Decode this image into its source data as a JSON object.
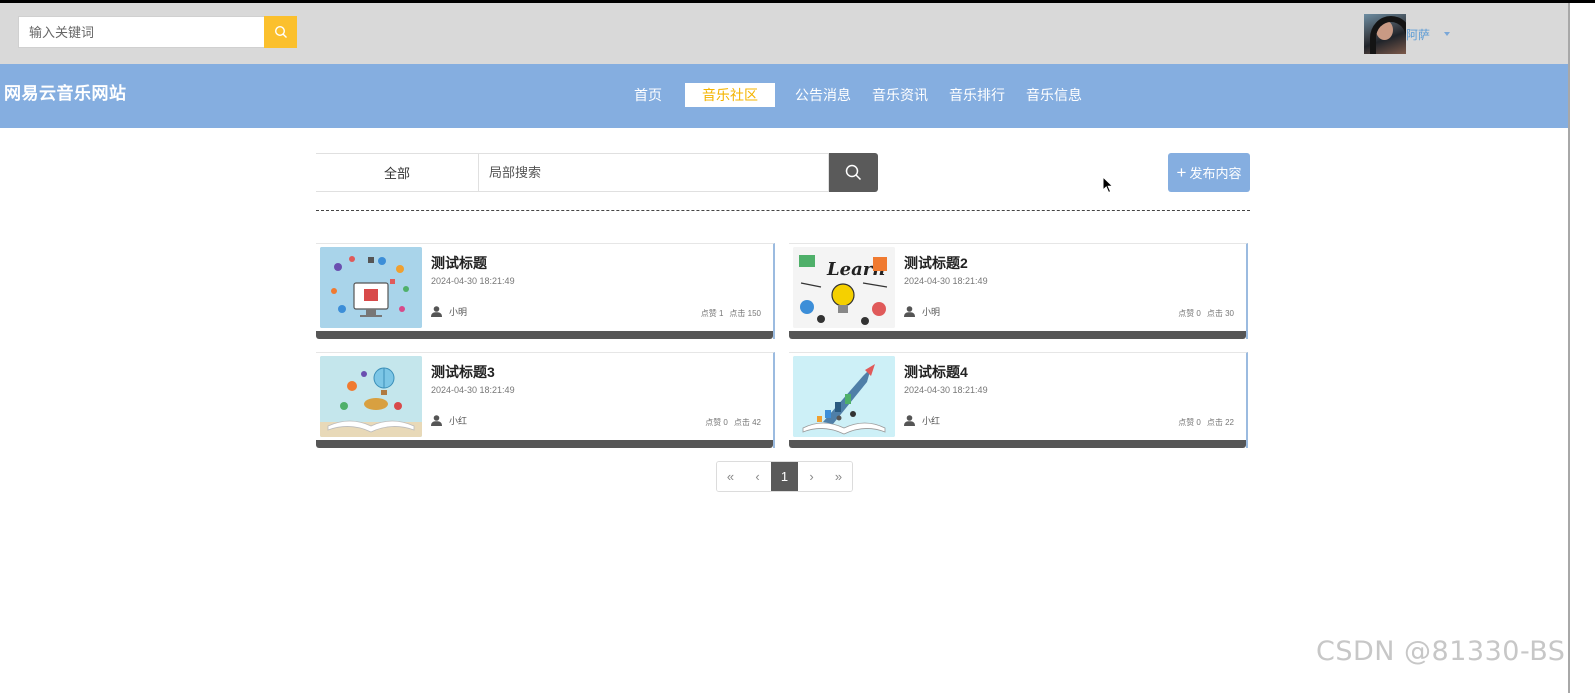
{
  "top": {
    "search_placeholder": "输入关键词",
    "user_name": "阿萨"
  },
  "site": {
    "logo": "网易云音乐网站"
  },
  "nav": [
    {
      "label": "首页",
      "active": false
    },
    {
      "label": "音乐社区",
      "active": true
    },
    {
      "label": "公告消息",
      "active": false
    },
    {
      "label": "音乐资讯",
      "active": false
    },
    {
      "label": "音乐排行",
      "active": false
    },
    {
      "label": "音乐信息",
      "active": false
    }
  ],
  "filter": {
    "category": "全部",
    "search_placeholder": "局部搜索",
    "publish_label": "发布内容",
    "publish_icon": "+"
  },
  "posts": [
    {
      "title": "测试标题",
      "date": "2024-04-30 18:21:49",
      "author": "小明",
      "likes": "点赞 1",
      "clicks": "点击 150",
      "image": "tech-illustration"
    },
    {
      "title": "测试标题2",
      "date": "2024-04-30 18:21:49",
      "author": "小明",
      "likes": "点赞 0",
      "clicks": "点击 30",
      "image": "learn-doodle"
    },
    {
      "title": "测试标题3",
      "date": "2024-04-30 18:21:49",
      "author": "小红",
      "likes": "点赞 0",
      "clicks": "点击 42",
      "image": "open-book-balloon"
    },
    {
      "title": "测试标题4",
      "date": "2024-04-30 18:21:49",
      "author": "小红",
      "likes": "点赞 0",
      "clicks": "点击 22",
      "image": "book-rocket"
    }
  ],
  "pagination": {
    "first": "«",
    "prev": "‹",
    "current": "1",
    "next": "›",
    "last": "»"
  },
  "watermark": "CSDN @81330-BS",
  "colors": {
    "accent_blue": "#85aee0",
    "accent_yellow": "#fbc02d",
    "dark_gray": "#5a5a5a"
  }
}
